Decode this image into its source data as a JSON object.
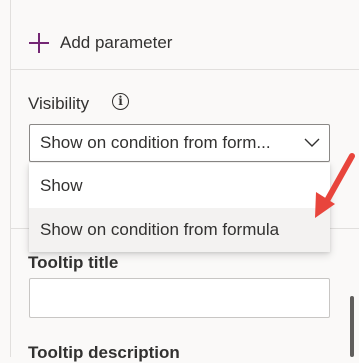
{
  "params": {
    "add_label": "Add parameter"
  },
  "visibility": {
    "label": "Visibility",
    "info_glyph": "i",
    "selected_value": "Show on condition from form...",
    "options": [
      "Show",
      "Show on condition from formula"
    ]
  },
  "tooltip": {
    "title_label": "Tooltip title",
    "title_value": "",
    "description_label": "Tooltip description"
  },
  "colors": {
    "accent": "#742774",
    "annotation_arrow": "#e8453c"
  },
  "icons": {
    "add": "plus-icon",
    "info": "info-icon",
    "dropdown": "chevron-down-icon",
    "annotation": "red-arrow-icon"
  }
}
